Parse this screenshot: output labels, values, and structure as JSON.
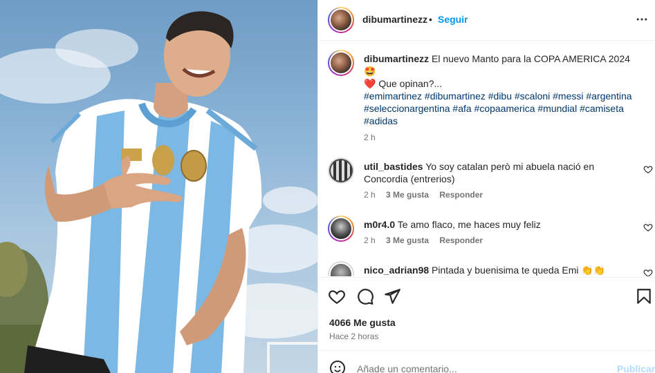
{
  "header": {
    "username": "dibumartinezz",
    "dot": "•",
    "follow_label": "Seguir",
    "more_icon": "more-horizontal-icon"
  },
  "caption": {
    "username": "dibumartinezz",
    "text": "El nuevo Manto para la COPA AMERICA 2024🤩",
    "text2": "❤️ Que opinan?...",
    "hashtags_line1": "#emimartinez #dibumartinez #dibu #scaloni #messi #argentina",
    "hashtags_line2": "#seleccionargentina #afa #copaamerica #mundial #camiseta",
    "hashtags_line3": "#adidas",
    "time": "2 h"
  },
  "comments": [
    {
      "username": "util_bastides",
      "text": "Yo soy catalan però mi abuela nació en Concordia (entrerios)",
      "time": "2 h",
      "likes": "3 Me gusta",
      "reply": "Responder"
    },
    {
      "username": "m0r4.0",
      "text": "Te amo flaco, me haces muy feliz",
      "time": "2 h",
      "likes": "3 Me gusta",
      "reply": "Responder"
    },
    {
      "username": "nico_adrian98",
      "text": "Pintada y buenisima te queda Emi 👏👏"
    }
  ],
  "actions": {
    "icons": [
      "heart-icon",
      "comment-icon",
      "share-icon",
      "bookmark-icon"
    ],
    "likes": "4066 Me gusta",
    "ago": "Hace 2 horas"
  },
  "add_comment": {
    "placeholder": "Añade un comentario...",
    "publish_label": "Publicar"
  },
  "colors": {
    "accent": "#0095f6",
    "text": "#262626",
    "muted": "#737373",
    "hashtag": "#00376b",
    "publish_disabled": "#b3dbff",
    "jersey_sky": "#7cb8e4"
  }
}
